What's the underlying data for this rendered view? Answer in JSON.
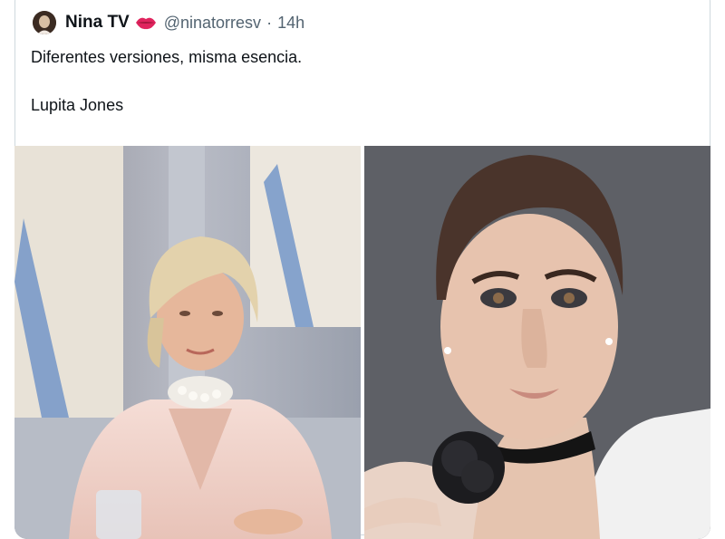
{
  "tweet": {
    "display_name": "Nina TV",
    "name_emoji_icon": "lips-icon",
    "handle": "@ninatorresv",
    "separator": "·",
    "time": "14h",
    "text_line_1": "Diferentes versiones, misma esencia.",
    "text_line_2": "Lupita Jones"
  },
  "media": {
    "photos": [
      {
        "icon": "photo-older-woman-pink-suit"
      },
      {
        "icon": "photo-woman-black-choker"
      }
    ]
  },
  "colors": {
    "name": "#0f1419",
    "secondary": "#536471",
    "border": "#cfd9de",
    "lips": "#e0245e"
  }
}
